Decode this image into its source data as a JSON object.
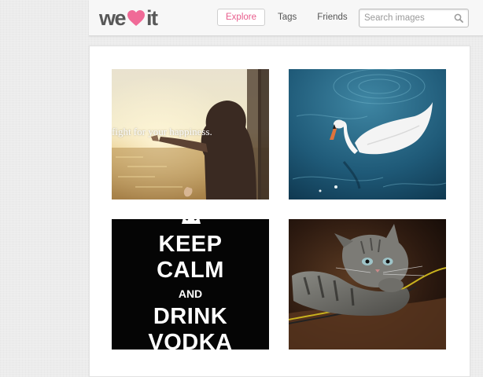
{
  "brand": {
    "logo_left": "we",
    "logo_right": "it",
    "accent_color": "#f06a97",
    "text_color": "#585858"
  },
  "nav": {
    "items": [
      {
        "label": "Explore",
        "active": true
      },
      {
        "label": "Tags",
        "active": false
      },
      {
        "label": "Friends",
        "active": false
      }
    ]
  },
  "search": {
    "placeholder": "Search images",
    "value": "",
    "icon": "search-icon"
  },
  "images": [
    {
      "subject": "child reaching toward sunset sea",
      "caption": "fight for your happiness."
    },
    {
      "subject": "white swan on blue water"
    },
    {
      "subject": "keep calm poster",
      "lines": [
        "KEEP",
        "CALM",
        "AND",
        "DRINK",
        "VODKA"
      ]
    },
    {
      "subject": "tabby kitten lying down"
    }
  ]
}
